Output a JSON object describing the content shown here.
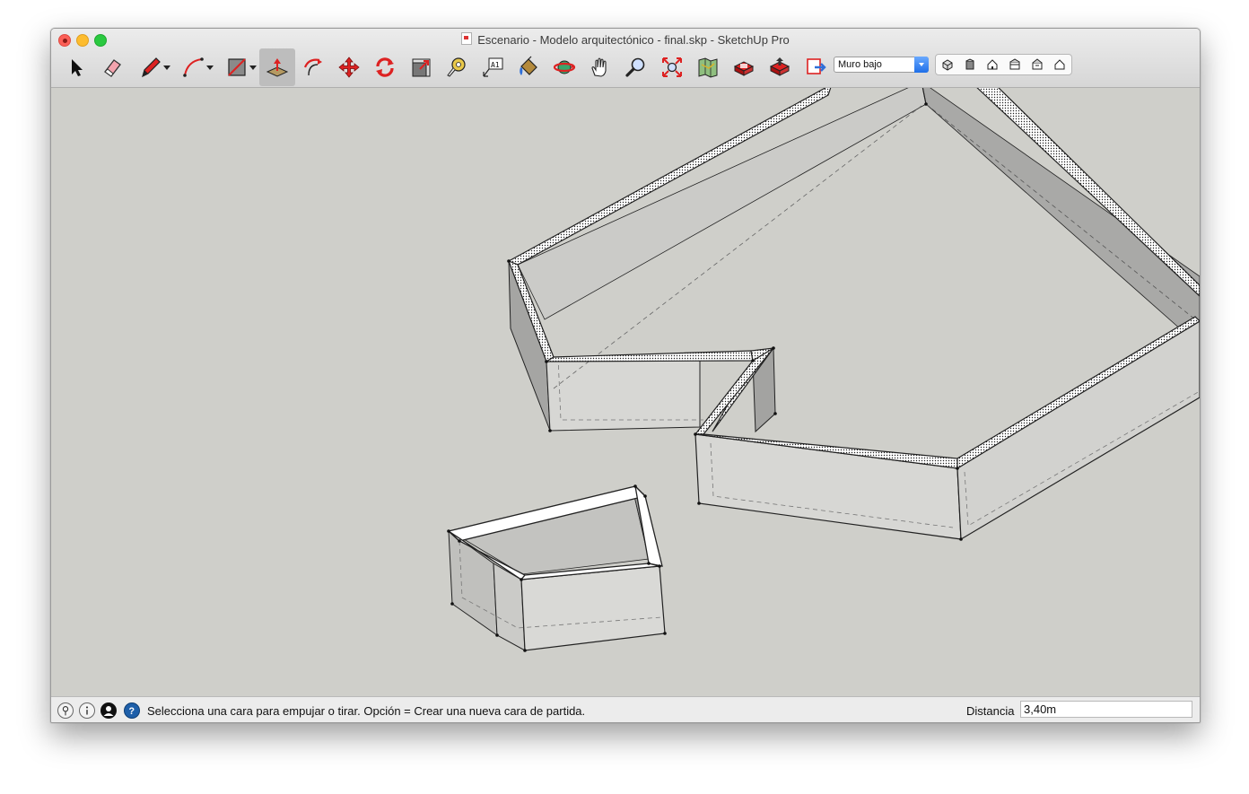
{
  "window": {
    "title": "Escenario - Modelo arquitectónico - final.skp - SketchUp Pro"
  },
  "toolbar": {
    "tools": [
      {
        "name": "select",
        "icon": "select-arrow-icon"
      },
      {
        "name": "eraser",
        "icon": "eraser-icon"
      },
      {
        "name": "pencil",
        "icon": "pencil-icon",
        "dropdown": true
      },
      {
        "name": "arc",
        "icon": "arc-icon",
        "dropdown": true
      },
      {
        "name": "shapes",
        "icon": "rectangle-icon",
        "dropdown": true
      },
      {
        "name": "push-pull",
        "icon": "push-pull-icon",
        "active": true
      },
      {
        "name": "offset",
        "icon": "offset-icon"
      },
      {
        "name": "move",
        "icon": "move-icon"
      },
      {
        "name": "rotate",
        "icon": "rotate-icon"
      },
      {
        "name": "scale",
        "icon": "scale-icon"
      },
      {
        "name": "tape-measure",
        "icon": "tape-measure-icon"
      },
      {
        "name": "text",
        "icon": "text-icon"
      },
      {
        "name": "paint-bucket",
        "icon": "paint-bucket-icon"
      },
      {
        "name": "orbit",
        "icon": "orbit-icon"
      },
      {
        "name": "pan",
        "icon": "pan-hand-icon"
      },
      {
        "name": "zoom",
        "icon": "zoom-icon"
      },
      {
        "name": "zoom-extents",
        "icon": "zoom-extents-icon"
      },
      {
        "name": "add-location",
        "icon": "geo-location-icon"
      },
      {
        "name": "warehouse",
        "icon": "3d-warehouse-icon"
      },
      {
        "name": "share-model",
        "icon": "share-model-icon"
      },
      {
        "name": "extension-warehouse",
        "icon": "extension-warehouse-icon"
      }
    ],
    "layer_selected": "Muro bajo",
    "views": [
      {
        "name": "iso",
        "icon": "iso-view-icon"
      },
      {
        "name": "top",
        "icon": "top-view-icon"
      },
      {
        "name": "front",
        "icon": "front-view-icon"
      },
      {
        "name": "right",
        "icon": "right-view-icon"
      },
      {
        "name": "back",
        "icon": "back-view-icon"
      },
      {
        "name": "left",
        "icon": "left-view-icon"
      }
    ]
  },
  "status": {
    "message": "Selecciona una cara para empujar o tirar. Opción = Crear una nueva cara de partida.",
    "measure_label": "Distancia",
    "measure_value": "3,40m"
  },
  "colors": {
    "canvas": "#cfcfca",
    "face_light": "#d9d9d6",
    "face_mid": "#bdbdbb",
    "face_dark": "#a9a9a7",
    "accent_red": "#d8262e"
  }
}
